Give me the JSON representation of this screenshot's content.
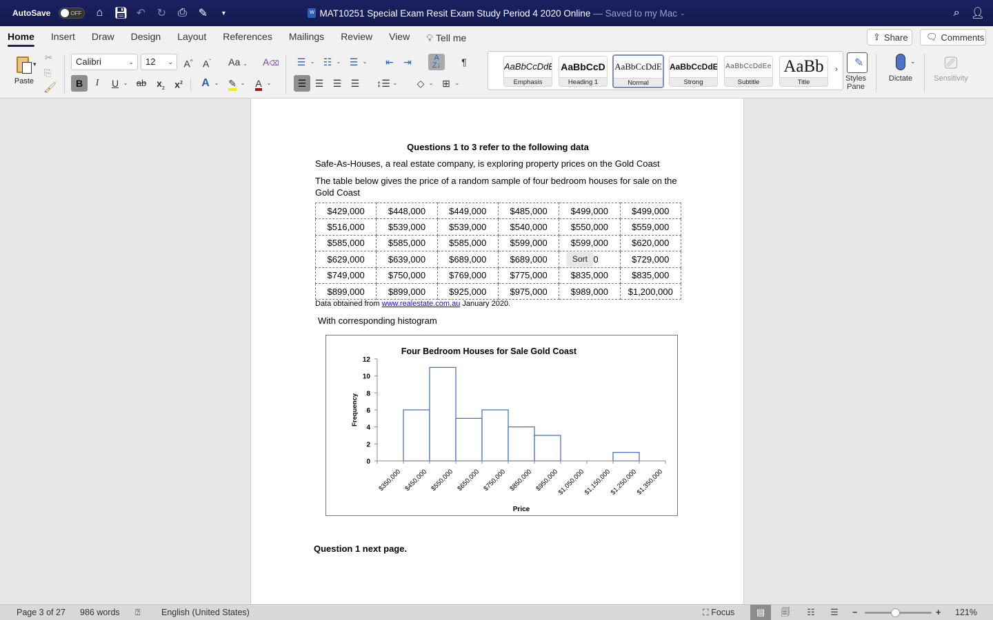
{
  "titlebar": {
    "autosave_label": "AutoSave",
    "autosave_state": "OFF",
    "doc_title": "MAT10251 Special Exam Resit Exam Study Period 4  2020 Online",
    "save_status": "— Saved to my Mac",
    "icons": [
      "home-icon",
      "save-icon",
      "undo-icon",
      "redo-icon",
      "print-icon",
      "edit-icon",
      "customize-toolbar-icon",
      "search-icon",
      "account-icon"
    ]
  },
  "ribbon": {
    "tabs": [
      {
        "label": "Home",
        "active": true
      },
      {
        "label": "Insert"
      },
      {
        "label": "Draw"
      },
      {
        "label": "Design"
      },
      {
        "label": "Layout"
      },
      {
        "label": "References"
      },
      {
        "label": "Mailings"
      },
      {
        "label": "Review"
      },
      {
        "label": "View"
      }
    ],
    "tell_me": "Tell me",
    "share": "Share",
    "comments": "Comments",
    "paste": "Paste",
    "font_name": "Calibri",
    "font_size": "12",
    "change_case": "Aa",
    "styles": [
      {
        "preview": "AaBbCcDdE",
        "name": "Emphasis"
      },
      {
        "preview": "AaBbCcD",
        "name": "Heading 1"
      },
      {
        "preview": "AaBbCcDdE",
        "name": "Normal",
        "selected": true
      },
      {
        "preview": "AaBbCcDdE",
        "name": "Strong"
      },
      {
        "preview": "AaBbCcDdEe",
        "name": "Subtitle"
      },
      {
        "preview": "AaBb",
        "name": "Title"
      }
    ],
    "styles_pane": "Styles Pane",
    "dictate": "Dictate",
    "sensitivity": "Sensitivity",
    "highlight_color": "#f2f200",
    "font_color": "#a31515"
  },
  "document": {
    "heading": "Questions 1 to 3 refer to the following data",
    "para1": "Safe-As-Houses, a real estate company, is exploring property prices on the Gold Coast",
    "para2_line1": "The table below gives the price of a random sample of four bedroom houses for sale on the",
    "para2_line2": "Gold Coast",
    "table": [
      [
        "$429,000",
        "$448,000",
        "$449,000",
        "$485,000",
        "$499,000",
        "$499,000"
      ],
      [
        "$516,000",
        "$539,000",
        "$539,000",
        "$540,000",
        "$550,000",
        "$559,000"
      ],
      [
        "$585,000",
        "$585,000",
        "$585,000",
        "$599,000",
        "$599,000",
        "$620,000"
      ],
      [
        "$629,000",
        "$639,000",
        "$689,000",
        "$689,000",
        ",000",
        "$729,000"
      ],
      [
        "$749,000",
        "$750,000",
        "$769,000",
        "$775,000",
        "$835,000",
        "$835,000"
      ],
      [
        "$899,000",
        "$899,000",
        "$925,000",
        "$975,000",
        "$989,000",
        "$1,200,000"
      ]
    ],
    "sort_tooltip": "Sort",
    "source_prefix": "Data obtained from ",
    "source_link": "www.realestate.com.au",
    "source_suffix": " January 2020.",
    "histogram_caption": "With corresponding histogram",
    "footer_note": "Question 1 next page."
  },
  "chart_data": {
    "type": "bar",
    "title": "Four Bedroom Houses for Sale Gold Coast",
    "xlabel": "Price",
    "ylabel": "Frequency",
    "ylim": [
      0,
      12
    ],
    "yticks": [
      0,
      2,
      4,
      6,
      8,
      10,
      12
    ],
    "categories": [
      "$350,000",
      "$450,000",
      "$550,000",
      "$650,000",
      "$750,000",
      "$850,000",
      "$950,000",
      "$1,050,000",
      "$1,150,000",
      "$1,250,000",
      "$1,350,000"
    ],
    "bins": [
      {
        "from": 400000,
        "to": 500000,
        "value": 6
      },
      {
        "from": 500000,
        "to": 600000,
        "value": 11
      },
      {
        "from": 600000,
        "to": 700000,
        "value": 5
      },
      {
        "from": 700000,
        "to": 800000,
        "value": 6
      },
      {
        "from": 800000,
        "to": 900000,
        "value": 4
      },
      {
        "from": 900000,
        "to": 1000000,
        "value": 3
      },
      {
        "from": 1000000,
        "to": 1100000,
        "value": 0
      },
      {
        "from": 1100000,
        "to": 1200000,
        "value": 0
      },
      {
        "from": 1200000,
        "to": 1300000,
        "value": 1
      }
    ],
    "xrange": [
      300000,
      1400000
    ],
    "grid": false,
    "bar_color": "#4f72bd"
  },
  "statusbar": {
    "page": "Page 3 of 27",
    "words": "986 words",
    "language": "English (United States)",
    "focus": "Focus",
    "zoom": "121%",
    "zoom_fraction": 0.45
  }
}
